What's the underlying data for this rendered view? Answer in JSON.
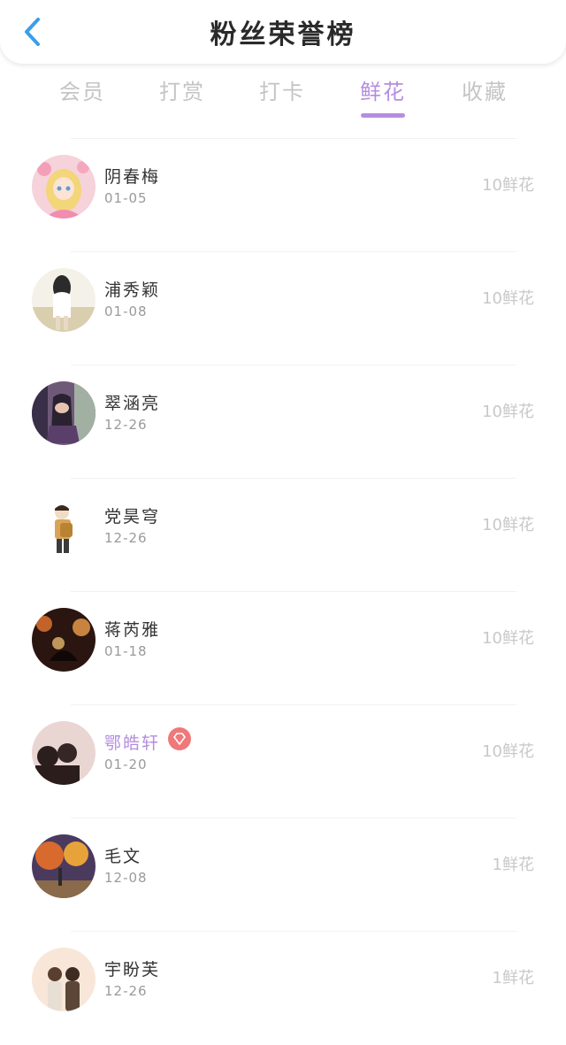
{
  "header": {
    "title": "粉丝荣誉榜",
    "back_icon": "chevron-left-icon",
    "back_color": "#3a9ee8"
  },
  "tabs": [
    {
      "label": "会员",
      "active": false
    },
    {
      "label": "打赏",
      "active": false
    },
    {
      "label": "打卡",
      "active": false
    },
    {
      "label": "鲜花",
      "active": true
    },
    {
      "label": "收藏",
      "active": false
    }
  ],
  "accent_color": "#b58de0",
  "fans": [
    {
      "name": "阴春梅",
      "date": "01-05",
      "amount": "10鲜花",
      "vip": false,
      "avatar": "anime-girl-avatar"
    },
    {
      "name": "浦秀颖",
      "date": "01-08",
      "amount": "10鲜花",
      "vip": false,
      "avatar": "girl-field-avatar"
    },
    {
      "name": "翠涵亮",
      "date": "12-26",
      "amount": "10鲜花",
      "vip": false,
      "avatar": "couple-street-avatar"
    },
    {
      "name": "党昊穹",
      "date": "12-26",
      "amount": "10鲜花",
      "vip": false,
      "avatar": "cartoon-boy-avatar"
    },
    {
      "name": "蒋芮雅",
      "date": "01-18",
      "amount": "10鲜花",
      "vip": false,
      "avatar": "night-lights-avatar"
    },
    {
      "name": "鄂皓轩",
      "date": "01-20",
      "amount": "10鲜花",
      "vip": true,
      "avatar": "silhouette-couple-avatar",
      "badge_icon": "diamond-icon"
    },
    {
      "name": "毛文",
      "date": "12-08",
      "amount": "1鲜花",
      "vip": false,
      "avatar": "autumn-street-avatar"
    },
    {
      "name": "宇盼芙",
      "date": "12-26",
      "amount": "1鲜花",
      "vip": false,
      "avatar": "illustrated-couple-avatar"
    }
  ]
}
